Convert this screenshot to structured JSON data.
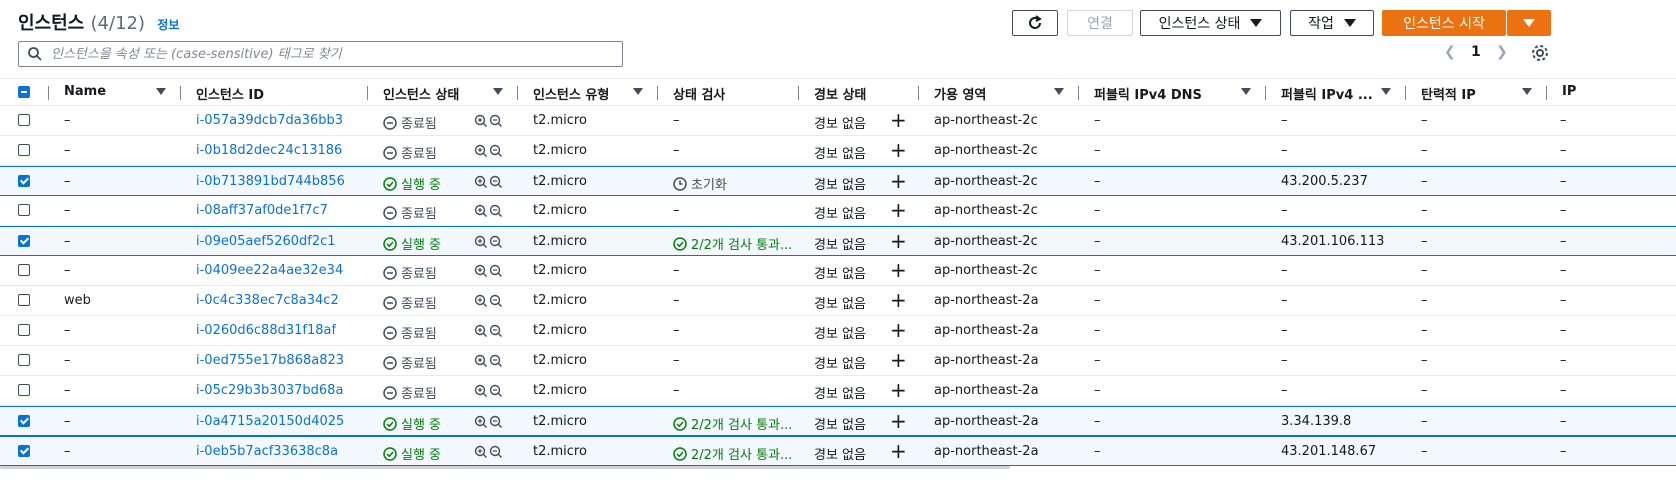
{
  "header": {
    "title": "인스턴스",
    "count": "(4/12)",
    "info": "정보"
  },
  "toolbar": {
    "connect_label": "연결",
    "state_label": "인스턴스 상태",
    "actions_label": "작업",
    "launch_label": "인스턴스 시작"
  },
  "search": {
    "placeholder": "인스턴스을 속성 또는 (case-sensitive) 태그로 찾기"
  },
  "pagination": {
    "page": "1"
  },
  "columns": {
    "name": "Name",
    "id": "인스턴스 ID",
    "state": "인스턴스 상태",
    "type": "인스턴스 유형",
    "check": "상태 검사",
    "alarm": "경보 상태",
    "az": "가용 영역",
    "dns": "퍼블릭 IPv4 DNS",
    "ip": "퍼블릭 IPv4 ...",
    "eip": "탄력적 IP",
    "next": "IP"
  },
  "rows": [
    {
      "selected": false,
      "name": "–",
      "id": "i-057a39dcb7da36bb3",
      "state": "종료됨",
      "state_kind": "terminated",
      "type": "t2.micro",
      "check": "–",
      "check_kind": "none",
      "alarm": "경보 없음",
      "az": "ap-northeast-2c",
      "dns": "–",
      "ip": "–",
      "eip": "–",
      "next": "–"
    },
    {
      "selected": false,
      "name": "–",
      "id": "i-0b18d2dec24c13186",
      "state": "종료됨",
      "state_kind": "terminated",
      "type": "t2.micro",
      "check": "–",
      "check_kind": "none",
      "alarm": "경보 없음",
      "az": "ap-northeast-2c",
      "dns": "–",
      "ip": "–",
      "eip": "–",
      "next": "–"
    },
    {
      "selected": true,
      "name": "–",
      "id": "i-0b713891bd744b856",
      "state": "실행 중",
      "state_kind": "running",
      "type": "t2.micro",
      "check": "초기화",
      "check_kind": "init",
      "alarm": "경보 없음",
      "az": "ap-northeast-2c",
      "dns": "–",
      "ip": "43.200.5.237",
      "eip": "–",
      "next": "–"
    },
    {
      "selected": false,
      "name": "–",
      "id": "i-08aff37af0de1f7c7",
      "state": "종료됨",
      "state_kind": "terminated",
      "type": "t2.micro",
      "check": "–",
      "check_kind": "none",
      "alarm": "경보 없음",
      "az": "ap-northeast-2c",
      "dns": "–",
      "ip": "–",
      "eip": "–",
      "next": "–"
    },
    {
      "selected": true,
      "name": "–",
      "id": "i-09e05aef5260df2c1",
      "state": "실행 중",
      "state_kind": "running",
      "type": "t2.micro",
      "check": "2/2개 검사 통과...",
      "check_kind": "pass",
      "alarm": "경보 없음",
      "az": "ap-northeast-2c",
      "dns": "–",
      "ip": "43.201.106.113",
      "eip": "–",
      "next": "–"
    },
    {
      "selected": false,
      "name": "–",
      "id": "i-0409ee22a4ae32e34",
      "state": "종료됨",
      "state_kind": "terminated",
      "type": "t2.micro",
      "check": "–",
      "check_kind": "none",
      "alarm": "경보 없음",
      "az": "ap-northeast-2c",
      "dns": "–",
      "ip": "–",
      "eip": "–",
      "next": "–"
    },
    {
      "selected": false,
      "name": "web",
      "id": "i-0c4c338ec7c8a34c2",
      "state": "종료됨",
      "state_kind": "terminated",
      "type": "t2.micro",
      "check": "–",
      "check_kind": "none",
      "alarm": "경보 없음",
      "az": "ap-northeast-2a",
      "dns": "–",
      "ip": "–",
      "eip": "–",
      "next": "–"
    },
    {
      "selected": false,
      "name": "–",
      "id": "i-0260d6c88d31f18af",
      "state": "종료됨",
      "state_kind": "terminated",
      "type": "t2.micro",
      "check": "–",
      "check_kind": "none",
      "alarm": "경보 없음",
      "az": "ap-northeast-2a",
      "dns": "–",
      "ip": "–",
      "eip": "–",
      "next": "–"
    },
    {
      "selected": false,
      "name": "–",
      "id": "i-0ed755e17b868a823",
      "state": "종료됨",
      "state_kind": "terminated",
      "type": "t2.micro",
      "check": "–",
      "check_kind": "none",
      "alarm": "경보 없음",
      "az": "ap-northeast-2a",
      "dns": "–",
      "ip": "–",
      "eip": "–",
      "next": "–"
    },
    {
      "selected": false,
      "name": "–",
      "id": "i-05c29b3b3037bd68a",
      "state": "종료됨",
      "state_kind": "terminated",
      "type": "t2.micro",
      "check": "–",
      "check_kind": "none",
      "alarm": "경보 없음",
      "az": "ap-northeast-2a",
      "dns": "–",
      "ip": "–",
      "eip": "–",
      "next": "–"
    },
    {
      "selected": true,
      "name": "–",
      "id": "i-0a4715a20150d4025",
      "state": "실행 중",
      "state_kind": "running",
      "type": "t2.micro",
      "check": "2/2개 검사 통과...",
      "check_kind": "pass",
      "alarm": "경보 없음",
      "az": "ap-northeast-2a",
      "dns": "–",
      "ip": "3.34.139.8",
      "eip": "–",
      "next": "–"
    },
    {
      "selected": true,
      "name": "–",
      "id": "i-0eb5b7acf33638c8a",
      "state": "실행 중",
      "state_kind": "running",
      "type": "t2.micro",
      "check": "2/2개 검사 통과...",
      "check_kind": "pass",
      "alarm": "경보 없음",
      "az": "ap-northeast-2a",
      "dns": "–",
      "ip": "43.201.148.67",
      "eip": "–",
      "next": "–"
    }
  ],
  "colors": {
    "accent": "#0972d3",
    "primary": "#ec7211",
    "success": "#037f0c"
  },
  "icons": {
    "refresh": "refresh-icon",
    "search": "search-icon",
    "settings": "gear-icon",
    "zoom": "zoom-icons",
    "add": "plus-icon"
  }
}
